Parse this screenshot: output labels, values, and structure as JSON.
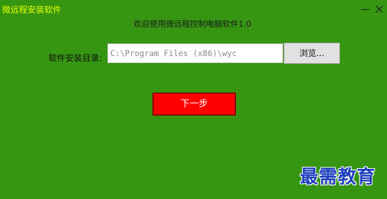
{
  "window": {
    "title": "微远程安装软件",
    "controls": {
      "minimize_icon": "minimize-icon",
      "close_icon": "close-icon"
    }
  },
  "main": {
    "welcome_text": "欢迎使用微远程控制电脑软件1.0",
    "install_dir": {
      "label": "软件安装目录:",
      "value": "C:\\Program Files (x86)\\wyc"
    },
    "browse_label": "浏览...",
    "next_label": "下一步"
  },
  "watermark": {
    "text": "最需教育"
  },
  "colors": {
    "background": "#369612",
    "title": "#e6ff00",
    "next_button": "#ff0000",
    "watermark": "#1f3fbf"
  }
}
